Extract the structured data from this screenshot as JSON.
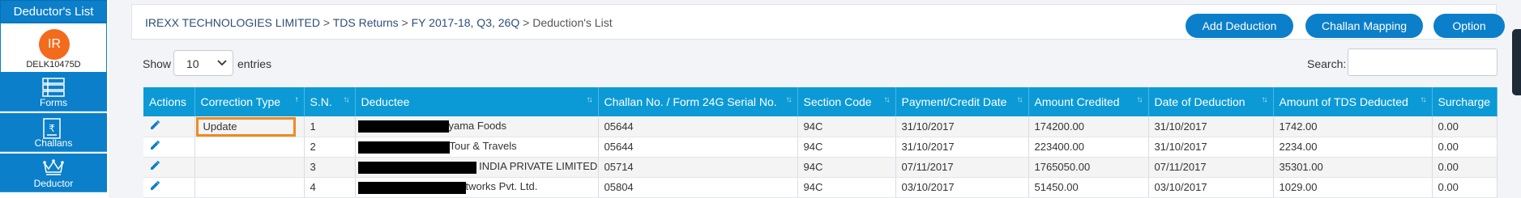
{
  "sidebar": {
    "title": "Deductor's List",
    "avatar_initials": "IR",
    "deductor_code": "DELK10475D",
    "items": [
      {
        "label": "Forms",
        "icon": "forms-icon"
      },
      {
        "label": "Challans",
        "icon": "challan-icon"
      },
      {
        "label": "Deductor",
        "icon": "crown-icon"
      }
    ]
  },
  "breadcrumb": {
    "company": "IREXX TECHNOLOGIES LIMITED",
    "section": "TDS Returns",
    "period": "FY 2017-18, Q3, 26Q",
    "current": "Deduction's List",
    "separator": ">"
  },
  "toolbar": {
    "add_deduction": "Add Deduction",
    "challan_mapping": "Challan Mapping",
    "option": "Option"
  },
  "length_control": {
    "show_label": "Show",
    "value": "10",
    "entries_label": "entries"
  },
  "search": {
    "label": "Search:",
    "value": ""
  },
  "table": {
    "columns": [
      "Actions",
      "Correction Type",
      "S.N.",
      "Deductee",
      "Challan No. / Form 24G Serial No.",
      "Section Code",
      "Payment/Credit Date",
      "Amount Credited",
      "Date of Deduction",
      "Amount of TDS Deducted",
      "Surcharge"
    ],
    "rows": [
      {
        "correction_type": "Update",
        "sn": "1",
        "deductee_visible": "yama Foods",
        "challan": "05644",
        "section": "94C",
        "payment_date": "31/10/2017",
        "amount_credited": "174200.00",
        "deduction_date": "31/10/2017",
        "tds": "1742.00",
        "surcharge": "0.00"
      },
      {
        "correction_type": "",
        "sn": "2",
        "deductee_visible": "Tour & Travels",
        "challan": "05644",
        "section": "94C",
        "payment_date": "31/10/2017",
        "amount_credited": "223400.00",
        "deduction_date": "31/10/2017",
        "tds": "2234.00",
        "surcharge": "0.00"
      },
      {
        "correction_type": "",
        "sn": "3",
        "deductee_visible": "INDIA PRIVATE LIMITED",
        "challan": "05714",
        "section": "94C",
        "payment_date": "07/11/2017",
        "amount_credited": "1765050.00",
        "deduction_date": "07/11/2017",
        "tds": "35301.00",
        "surcharge": "0.00"
      },
      {
        "correction_type": "",
        "sn": "4",
        "deductee_visible": "tworks Pvt. Ltd.",
        "challan": "05804",
        "section": "94C",
        "payment_date": "03/10/2017",
        "amount_credited": "51450.00",
        "deduction_date": "03/10/2017",
        "tds": "1029.00",
        "surcharge": "0.00"
      }
    ]
  },
  "colors": {
    "primary": "#0b7fc9",
    "header": "#0b9ad6",
    "avatar": "#f36b1d",
    "highlight": "#f08a24"
  }
}
